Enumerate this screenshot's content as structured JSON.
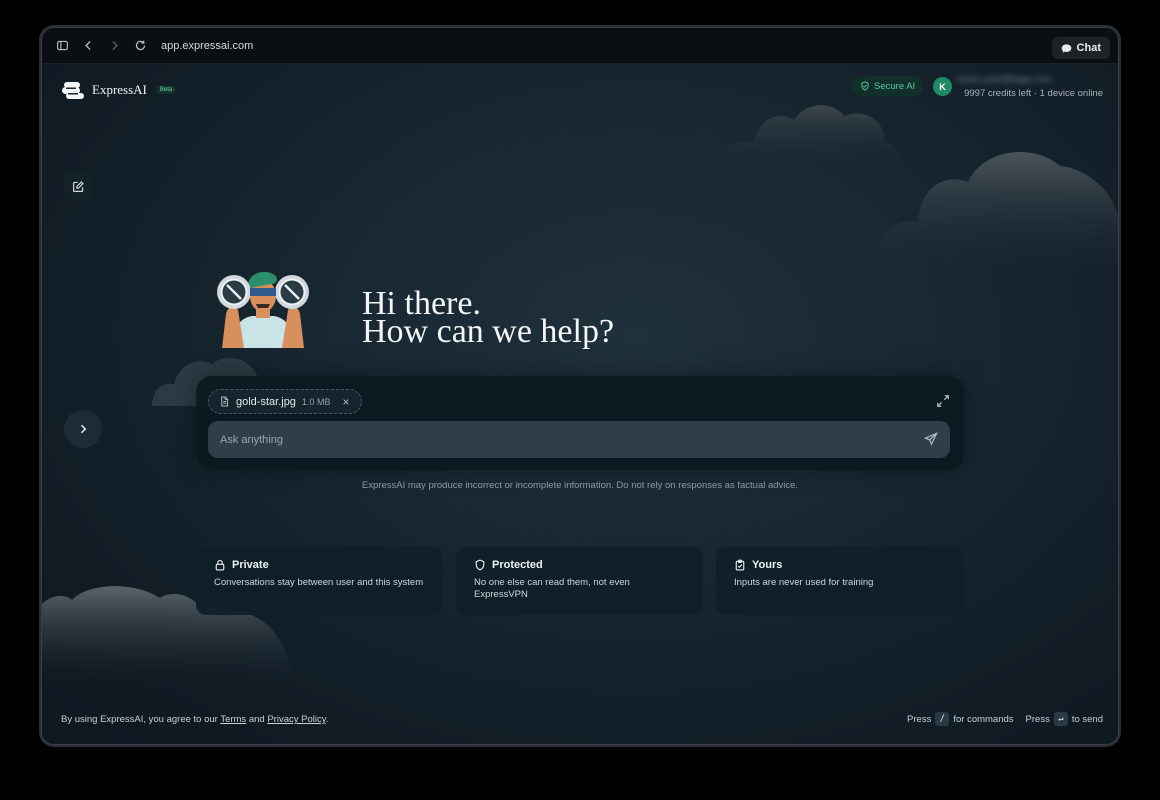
{
  "browser": {
    "url": "app.expressai.com",
    "chat_label": "Chat"
  },
  "header": {
    "brand": "ExpressAI",
    "badge": "Beta",
    "secure_label": "Secure AI",
    "avatar_initial": "K",
    "user_email": "kevin.user@fugai.com",
    "credits": "9997 credits left · 1 device online"
  },
  "hero": {
    "line1": "Hi there.",
    "line2": "How can we help?"
  },
  "composer": {
    "attachment_name": "gold-star.jpg",
    "attachment_size": "1.0 MB",
    "remove_glyph": "×",
    "placeholder": "Ask anything"
  },
  "disclaimer": "ExpressAI may produce incorrect or incomplete information. Do not rely on responses as factual advice.",
  "cards": [
    {
      "title": "Private",
      "desc": "Conversations stay between user and this system",
      "icon": "lock-icon"
    },
    {
      "title": "Protected",
      "desc": "No one else can read them, not even ExpressVPN",
      "icon": "shield-icon"
    },
    {
      "title": "Yours",
      "desc": "Inputs are never used for training",
      "icon": "clipboard-icon"
    }
  ],
  "footer": {
    "prefix": "By using ExpressAI, you agree to our ",
    "terms": "Terms",
    "and": " and ",
    "privacy": "Privacy Policy",
    "suffix": ".",
    "press1": "Press",
    "key1": "/",
    "for_commands": "for commands",
    "press2": "Press",
    "key2": "↵",
    "to_send": "to send"
  },
  "colors": {
    "background": "#17252f",
    "accent_green": "#5cc79f",
    "avatar": "#1f8a63"
  }
}
